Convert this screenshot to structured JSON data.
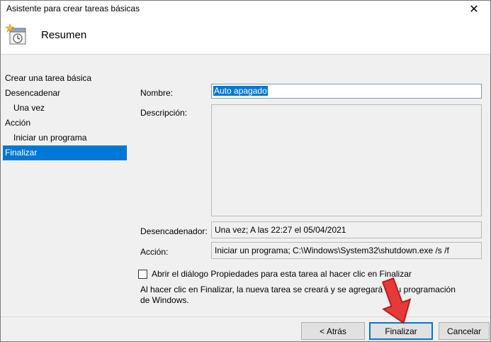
{
  "window": {
    "title": "Asistente para crear tareas básicas",
    "close_glyph": "✕"
  },
  "header": {
    "icon": "task-scheduler-icon",
    "title": "Resumen"
  },
  "steps": [
    {
      "label": "Crear una tarea básica",
      "indent": false,
      "active": false
    },
    {
      "label": "Desencadenar",
      "indent": false,
      "active": false
    },
    {
      "label": "Una vez",
      "indent": true,
      "active": false
    },
    {
      "label": "Acción",
      "indent": false,
      "active": false
    },
    {
      "label": "Iniciar un programa",
      "indent": true,
      "active": false
    },
    {
      "label": "Finalizar",
      "indent": false,
      "active": true
    }
  ],
  "form": {
    "name_label": "Nombre:",
    "name_value": "Auto apagado",
    "description_label": "Descripción:",
    "description_value": "",
    "trigger_label": "Desencadenador:",
    "trigger_value": "Una vez; A las 22:27 el 05/04/2021",
    "action_label": "Acción:",
    "action_value": "Iniciar un programa; C:\\Windows\\System32\\shutdown.exe /s /f"
  },
  "options": {
    "open_properties_label": "Abrir el diálogo Propiedades para esta tarea al hacer clic en Finalizar",
    "open_properties_checked": false,
    "info_text": "Al hacer clic en Finalizar, la nueva tarea se creará y se agregará a su programación de Windows."
  },
  "buttons": {
    "back_label": "< Atrás",
    "finish_label": "Finalizar",
    "cancel_label": "Cancelar"
  },
  "colors": {
    "accent": "#0078d7",
    "arrow": "#e8393a"
  }
}
